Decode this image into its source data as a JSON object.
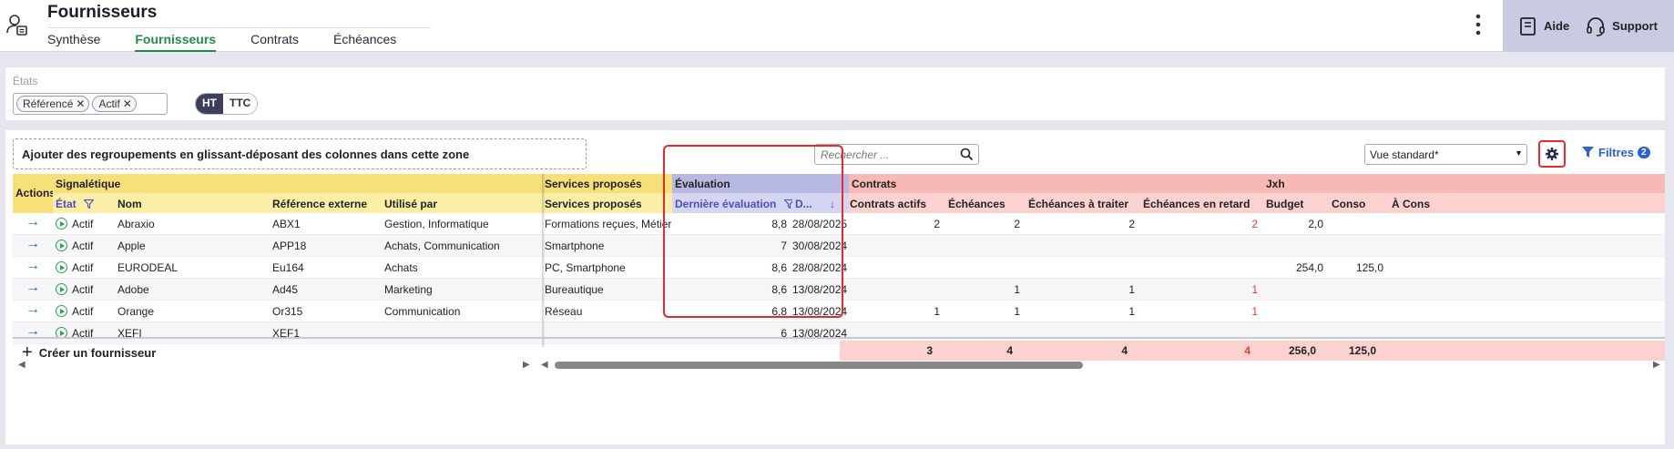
{
  "header": {
    "title": "Fournisseurs",
    "tabs": [
      {
        "label": "Synthèse"
      },
      {
        "label": "Fournisseurs",
        "active": true
      },
      {
        "label": "Contrats"
      },
      {
        "label": "Échéances"
      }
    ],
    "help_label": "Aide",
    "support_label": "Support"
  },
  "states": {
    "label": "États",
    "chips": [
      "Référencé",
      "Actif"
    ],
    "ht_label": "HT",
    "ttc_label": "TTC"
  },
  "toolbar": {
    "group_zone_text": "Ajouter des regroupements en glissant-déposant des colonnes dans cette zone",
    "search_placeholder": "Rechercher ...",
    "view_value": "Vue standard*",
    "filters_label": "Filtres",
    "filters_count": "2"
  },
  "groups": {
    "actions": "Actions",
    "signaletique": "Signalétique",
    "services": "Services proposés",
    "evaluation": "Évaluation",
    "contrats": "Contrats",
    "jxh": "Jxh"
  },
  "columns": {
    "etat": "État",
    "nom": "Nom",
    "ref": "Référence externe",
    "utilise": "Utilisé par",
    "services": "Services proposés",
    "derniere_eval": "Dernière évaluation",
    "date_eval": "D...",
    "contrats_actifs": "Contrats actifs",
    "echeances": "Échéances",
    "echeances_traiter": "Échéances à traiter",
    "echeances_retard": "Échéances en retard",
    "budget": "Budget",
    "conso": "Conso",
    "a_cons": "À Cons"
  },
  "rows": [
    {
      "etat": "Actif",
      "nom": "Abraxio",
      "ref": "ABX1",
      "utilise": "Gestion, Informatique",
      "services": "Formations reçues, Métier",
      "eval": "8,8",
      "date": "28/08/2025",
      "contrats_actifs": "2",
      "echeances": "2",
      "traiter": "2",
      "retard": "2",
      "budget": "2,0",
      "conso": ""
    },
    {
      "etat": "Actif",
      "nom": "Apple",
      "ref": "APP18",
      "utilise": "Achats, Communication",
      "services": "Smartphone",
      "eval": "7",
      "date": "30/08/2024",
      "contrats_actifs": "",
      "echeances": "",
      "traiter": "",
      "retard": "",
      "budget": "",
      "conso": ""
    },
    {
      "etat": "Actif",
      "nom": "EURODEAL",
      "ref": "Eu164",
      "utilise": "Achats",
      "services": "PC, Smartphone",
      "eval": "8,6",
      "date": "28/08/2024",
      "contrats_actifs": "",
      "echeances": "",
      "traiter": "",
      "retard": "",
      "budget": "254,0",
      "conso": "125,0"
    },
    {
      "etat": "Actif",
      "nom": "Adobe",
      "ref": "Ad45",
      "utilise": "Marketing",
      "services": "Bureautique",
      "eval": "8,6",
      "date": "13/08/2024",
      "contrats_actifs": "",
      "echeances": "1",
      "traiter": "1",
      "retard": "1",
      "budget": "",
      "conso": ""
    },
    {
      "etat": "Actif",
      "nom": "Orange",
      "ref": "Or315",
      "utilise": "Communication",
      "services": "Réseau",
      "eval": "6,8",
      "date": "13/08/2024",
      "contrats_actifs": "1",
      "echeances": "1",
      "traiter": "1",
      "retard": "1",
      "budget": "",
      "conso": ""
    },
    {
      "etat": "Actif",
      "nom": "XEFI",
      "ref": "XEF1",
      "utilise": "",
      "services": "",
      "eval": "6",
      "date": "13/08/2024",
      "contrats_actifs": "",
      "echeances": "",
      "traiter": "",
      "retard": "",
      "budget": "",
      "conso": ""
    }
  ],
  "footer": {
    "create_label": "Créer un fournisseur",
    "totals": {
      "contrats_actifs": "3",
      "echeances": "4",
      "traiter": "4",
      "retard": "4",
      "budget": "256,0",
      "conso": "125,0"
    }
  },
  "colors": {
    "accent_green": "#1f8f46",
    "signaletique_yellow": "#f7e07a",
    "evaluation_purple": "#b7b9e3",
    "contrats_pink": "#f7b9b5",
    "highlight_red": "#e52a2a",
    "link_blue": "#2b62d8"
  }
}
